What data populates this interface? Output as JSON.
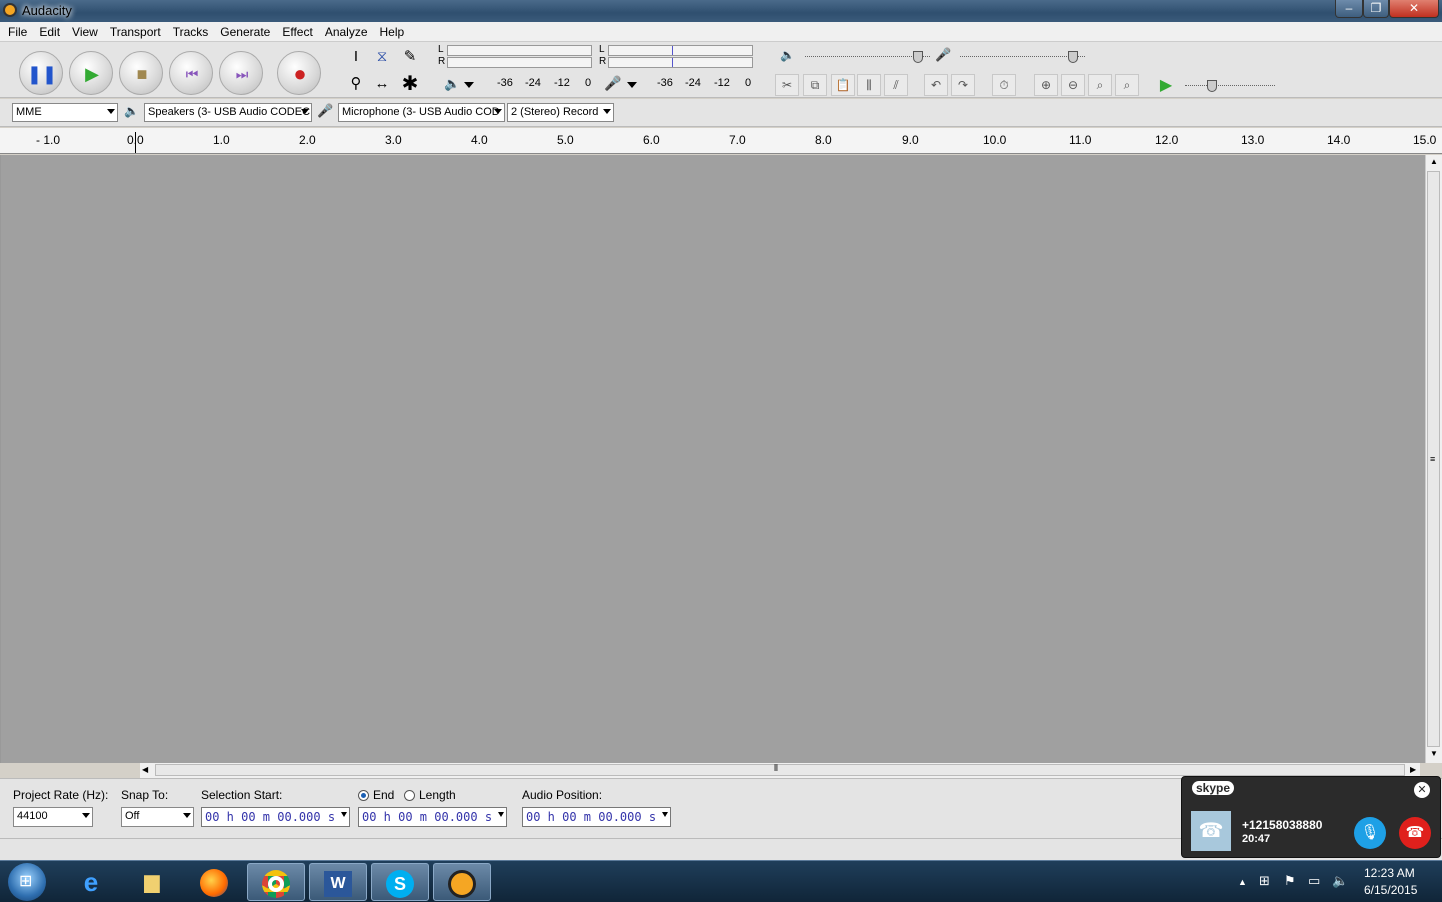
{
  "window": {
    "title": "Audacity",
    "controls": [
      "–",
      "❐",
      "✕"
    ]
  },
  "menu": [
    "File",
    "Edit",
    "View",
    "Transport",
    "Tracks",
    "Generate",
    "Effect",
    "Analyze",
    "Help"
  ],
  "transport": {
    "pause_icon": "pause-icon",
    "play_icon": "play-icon",
    "stop_icon": "stop-icon",
    "skip_start_icon": "skip-start-icon",
    "skip_end_icon": "skip-end-icon",
    "record_icon": "record-icon",
    "colors": {
      "pause": "#2255cc",
      "play": "#33aa33",
      "stop": "#a08850",
      "skip": "#8855bb",
      "record": "#cc2222"
    }
  },
  "tools": [
    "I",
    "⌶",
    "✎",
    "🔍",
    "↔",
    "✱"
  ],
  "meters": {
    "play": {
      "L": "L",
      "R": "R",
      "scale": [
        "-36",
        "-24",
        "-12",
        "0"
      ]
    },
    "record": {
      "L": "L",
      "R": "R",
      "scale": [
        "-36",
        "-24",
        "-12",
        "0"
      ]
    }
  },
  "mixer": {
    "play_volume": 0.75,
    "record_volume": 0.75
  },
  "play_at_speed": 0.3,
  "devices": {
    "host": "MME",
    "output": "Speakers (3- USB Audio CODEC",
    "input": "Microphone (3- USB Audio COD",
    "channels": "2 (Stereo) Record"
  },
  "ruler": {
    "labels": [
      "- 1.0",
      "0.0",
      "1.0",
      "2.0",
      "3.0",
      "4.0",
      "5.0",
      "6.0",
      "7.0",
      "8.0",
      "9.0",
      "10.0",
      "11.0",
      "12.0",
      "13.0",
      "14.0",
      "15.0"
    ]
  },
  "selection": {
    "project_rate_label": "Project Rate (Hz):",
    "project_rate": "44100",
    "snap_to_label": "Snap To:",
    "snap_to": "Off",
    "selection_start_label": "Selection Start:",
    "end_label": "End",
    "length_label": "Length",
    "audio_position_label": "Audio Position:",
    "start_time": "00 h 00 m 00.000 s",
    "end_time": "00 h 00 m 00.000 s",
    "position_time": "00 h 00 m 00.000 s"
  },
  "skype": {
    "brand": "skype",
    "number": "+12158038880",
    "duration": "20:47"
  },
  "taskbar": {
    "time": "12:23 AM",
    "date": "6/15/2015"
  }
}
